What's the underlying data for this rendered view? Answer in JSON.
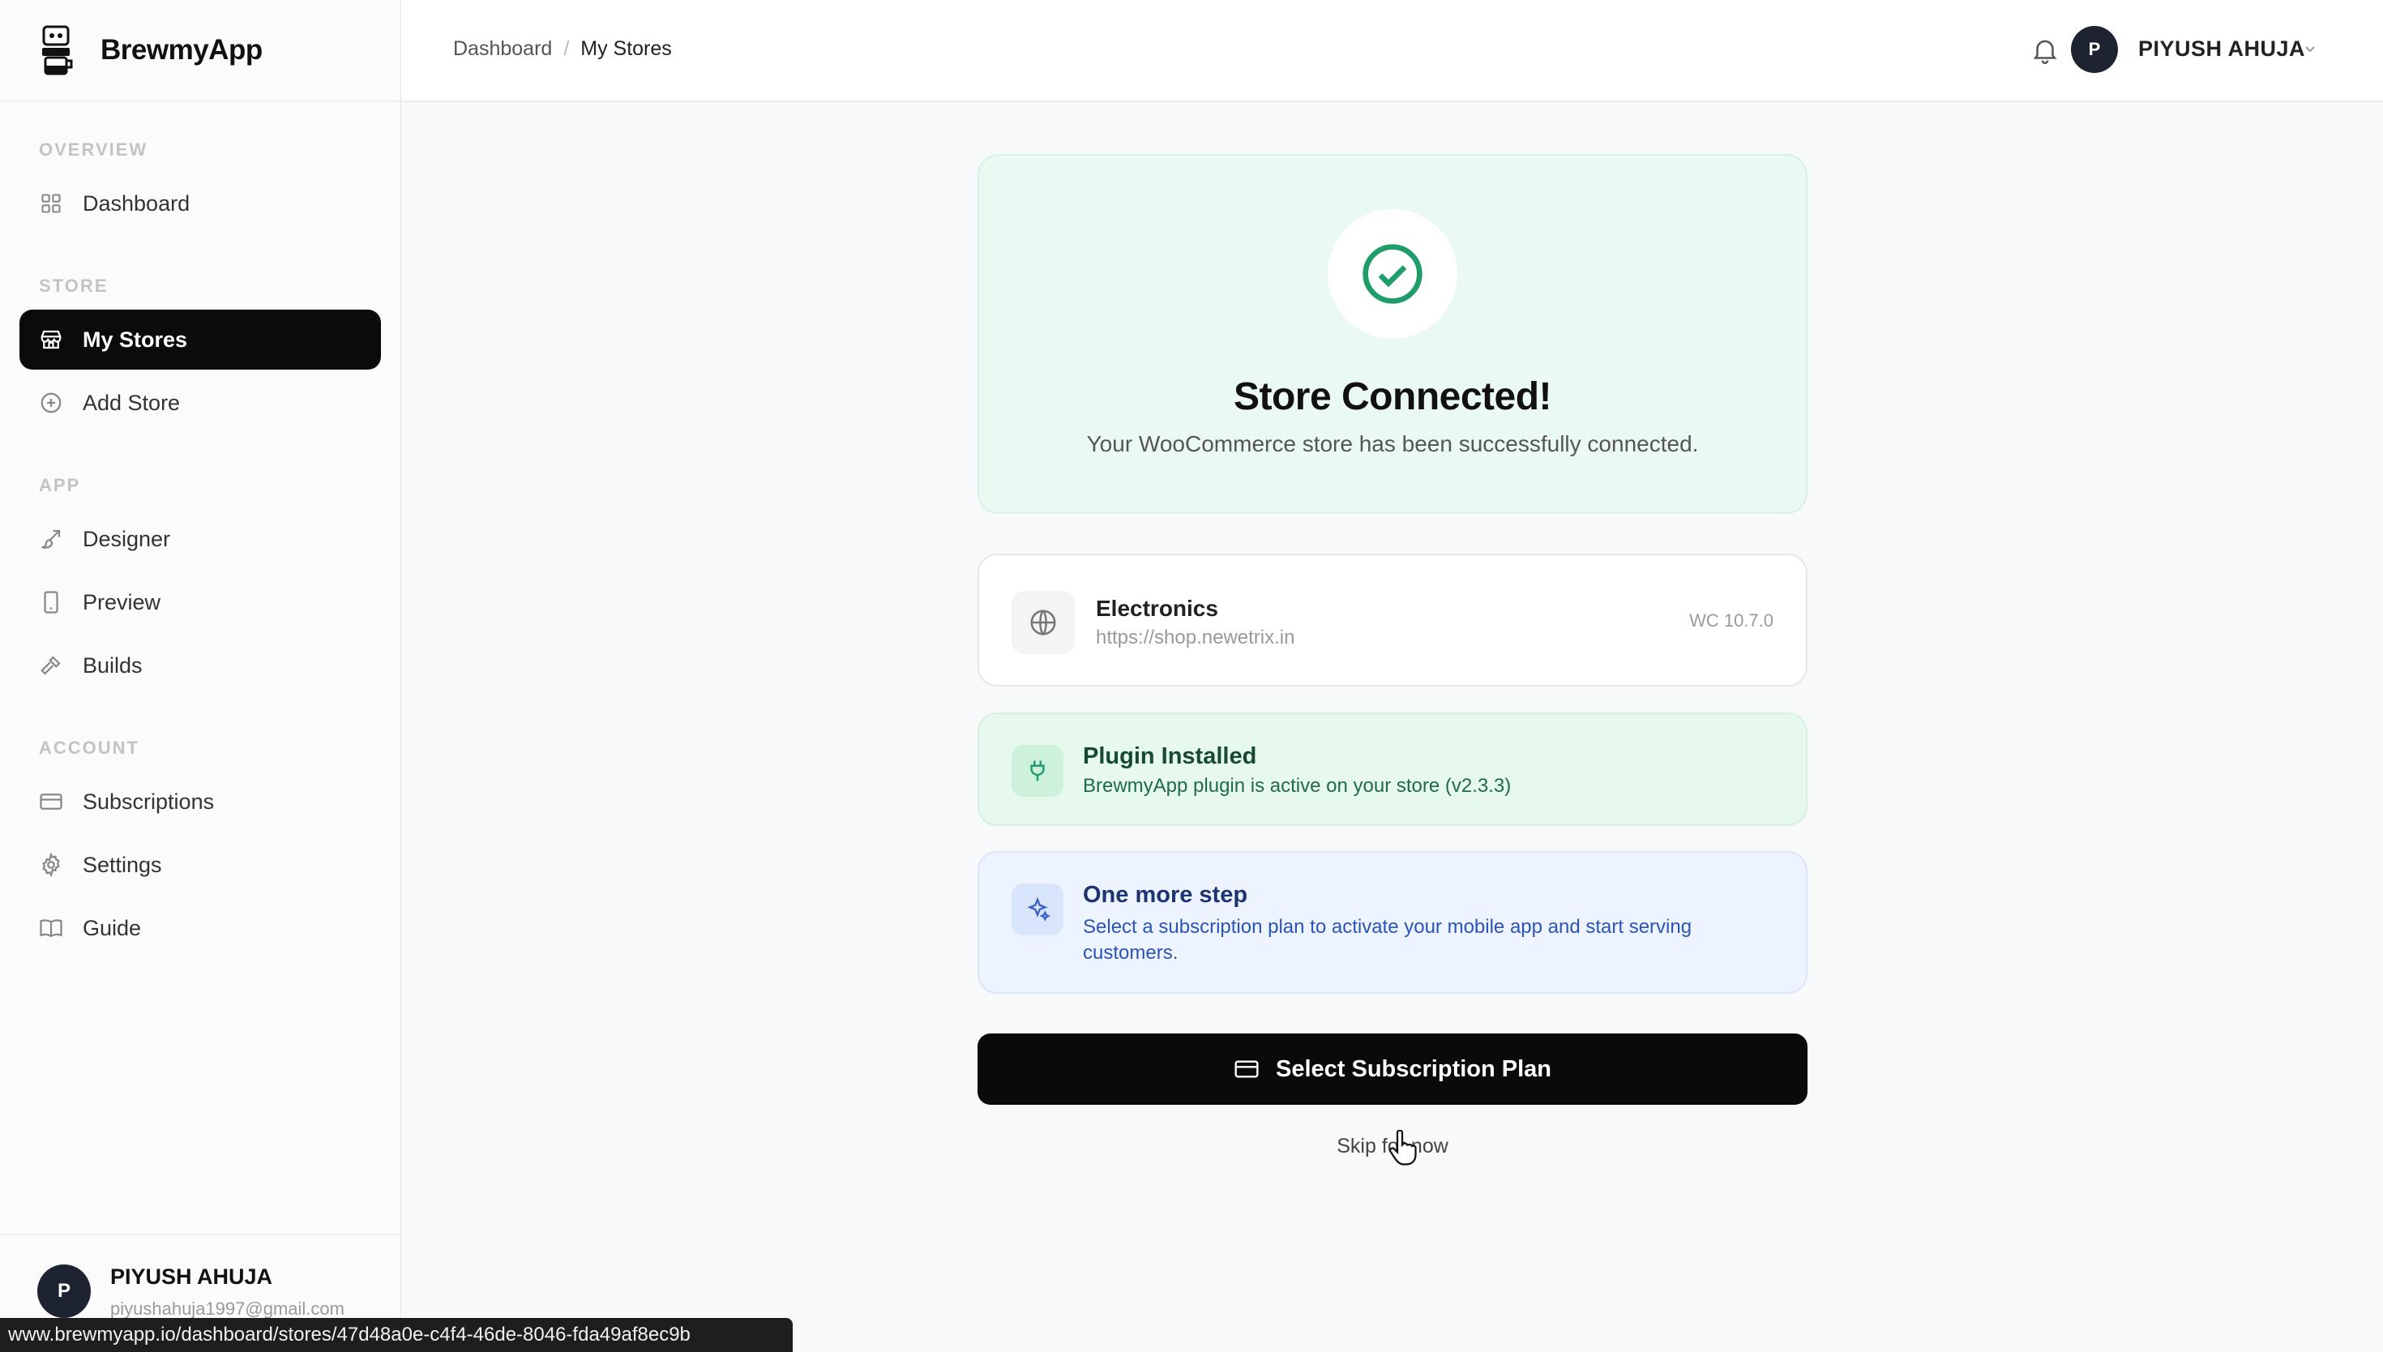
{
  "app": {
    "name": "BrewmyApp"
  },
  "breadcrumb": {
    "root": "Dashboard",
    "separator": "/",
    "current": "My Stores"
  },
  "header": {
    "avatar_initial": "P",
    "user_name": "PIYUSH AHUJA"
  },
  "sidebar": {
    "sections": [
      {
        "label": "OVERVIEW"
      },
      {
        "label": "STORE"
      },
      {
        "label": "APP"
      },
      {
        "label": "ACCOUNT"
      }
    ],
    "items": [
      {
        "label": "Dashboard",
        "icon": "grid-icon"
      },
      {
        "label": "My Stores",
        "icon": "store-icon",
        "active": true
      },
      {
        "label": "Add Store",
        "icon": "plus-circle-icon"
      },
      {
        "label": "Designer",
        "icon": "brush-icon"
      },
      {
        "label": "Preview",
        "icon": "phone-icon"
      },
      {
        "label": "Builds",
        "icon": "hammer-icon"
      },
      {
        "label": "Subscriptions",
        "icon": "card-icon"
      },
      {
        "label": "Settings",
        "icon": "gear-icon"
      },
      {
        "label": "Guide",
        "icon": "book-icon"
      }
    ],
    "user": {
      "avatar_initial": "P",
      "name": "PIYUSH AHUJA",
      "email": "piyushahuja1997@gmail.com"
    }
  },
  "success": {
    "title": "Store Connected!",
    "subtitle": "Your WooCommerce store has been successfully connected."
  },
  "store": {
    "name": "Electronics",
    "url": "https://shop.newetrix.in",
    "version": "WC 10.7.0"
  },
  "plugin": {
    "title": "Plugin Installed",
    "subtitle": "BrewmyApp plugin is active on your store (v2.3.3)"
  },
  "next_step": {
    "title": "One more step",
    "subtitle": "Select a subscription plan to activate your mobile app and start serving customers."
  },
  "actions": {
    "primary": "Select Subscription Plan",
    "skip": "Skip for now"
  },
  "status_bar": {
    "url": "www.brewmyapp.io/dashboard/stores/47d48a0e-c4f4-46de-8046-fda49af8ec9b"
  },
  "colors": {
    "accent_dark": "#0a0a0a",
    "success_bg": "#eafaf3",
    "success_icon": "#1f9d6a",
    "info_bg": "#eef4ff",
    "info_text": "#2b54b8"
  }
}
